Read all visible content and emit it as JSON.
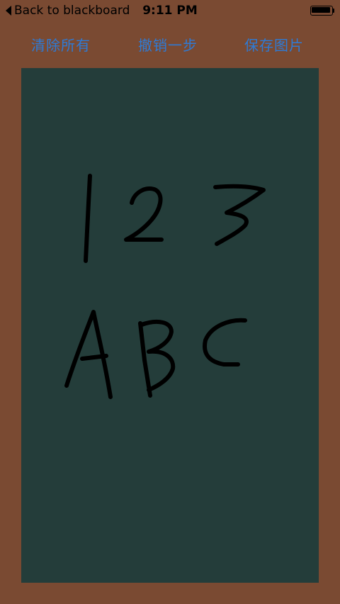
{
  "status_bar": {
    "back_label": "Back to blackboard",
    "time": "9:11 PM",
    "battery_level": 1.0
  },
  "toolbar": {
    "clear_label": "清除所有",
    "undo_label": "撤销一步",
    "save_label": "保存图片"
  },
  "colors": {
    "frame": "#7a4a32",
    "board": "#243d3a",
    "ink": "#000000",
    "button_text": "#2e7bd6"
  }
}
